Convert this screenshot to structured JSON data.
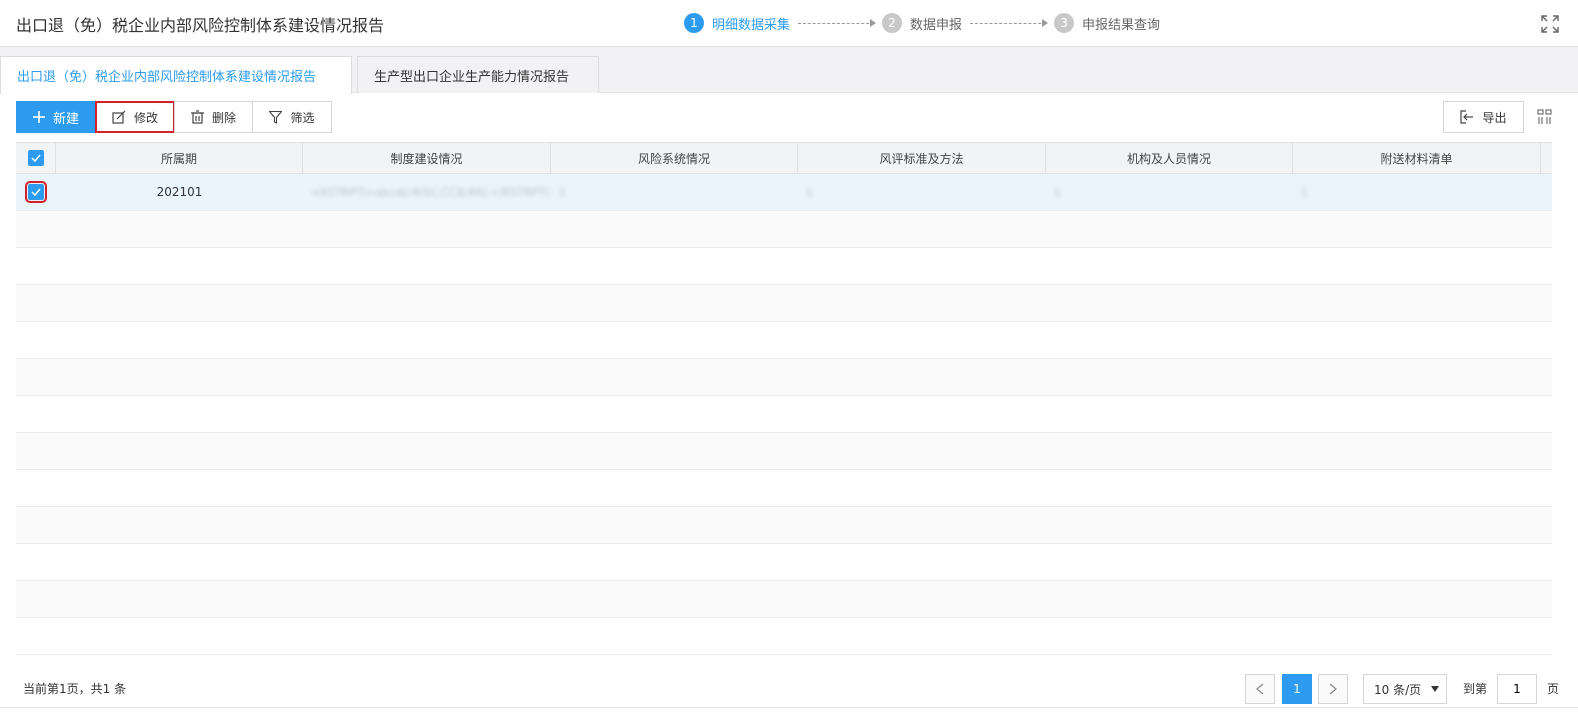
{
  "header": {
    "title": "出口退（免）税企业内部风险控制体系建设情况报告",
    "steps": [
      {
        "num": "1",
        "label": "明细数据采集"
      },
      {
        "num": "2",
        "label": "数据申报"
      },
      {
        "num": "3",
        "label": "申报结果查询"
      }
    ],
    "fullscreen_icon": "fullscreen-icon"
  },
  "tabs": [
    {
      "label": "出口退（免）税企业内部风险控制体系建设情况报告",
      "active": true
    },
    {
      "label": "生产型出口企业生产能力情况报告",
      "active": false
    }
  ],
  "toolbar": {
    "new_label": "新建",
    "edit_label": "修改",
    "delete_label": "删除",
    "filter_label": "筛选",
    "export_label": "导出"
  },
  "table": {
    "columns": [
      "所属期",
      "制度建设情况",
      "风险系统情况",
      "风评标准及方法",
      "机构及人员情况",
      "附送材料清单"
    ],
    "rows": [
      {
        "period": "202101",
        "c1": "<RSTRPTI>abcde;RISC;CCB;RKI;</RSTRPTI>",
        "c2": "1",
        "c3": "1",
        "c4": "1",
        "c5": "1"
      }
    ]
  },
  "pagination": {
    "info": "当前第1页，共1 条",
    "current": "1",
    "page_size": "10 条/页",
    "goto_label": "到第",
    "goto_value": "1",
    "suffix": "页"
  },
  "colors": {
    "accent": "#2d9cf0",
    "highlight_border": "#d0232b",
    "selected_row": "#eaf4fd"
  }
}
